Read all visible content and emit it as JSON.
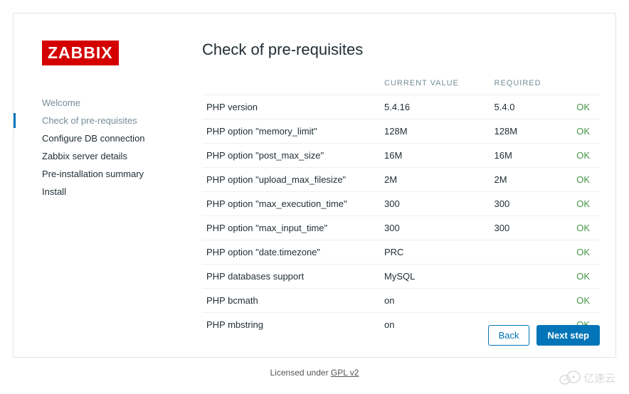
{
  "logo": "ZABBIX",
  "sidebar": {
    "items": [
      {
        "label": "Welcome",
        "state": "done"
      },
      {
        "label": "Check of pre-requisites",
        "state": "active"
      },
      {
        "label": "Configure DB connection",
        "state": "future"
      },
      {
        "label": "Zabbix server details",
        "state": "future"
      },
      {
        "label": "Pre-installation summary",
        "state": "future"
      },
      {
        "label": "Install",
        "state": "future"
      }
    ]
  },
  "main": {
    "title": "Check of pre-requisites",
    "columns": {
      "empty": "",
      "current": "Current value",
      "required": "Required",
      "status": ""
    },
    "rows": [
      {
        "name": "PHP version",
        "current": "5.4.16",
        "required": "5.4.0",
        "status": "OK"
      },
      {
        "name": "PHP option \"memory_limit\"",
        "current": "128M",
        "required": "128M",
        "status": "OK"
      },
      {
        "name": "PHP option \"post_max_size\"",
        "current": "16M",
        "required": "16M",
        "status": "OK"
      },
      {
        "name": "PHP option \"upload_max_filesize\"",
        "current": "2M",
        "required": "2M",
        "status": "OK"
      },
      {
        "name": "PHP option \"max_execution_time\"",
        "current": "300",
        "required": "300",
        "status": "OK"
      },
      {
        "name": "PHP option \"max_input_time\"",
        "current": "300",
        "required": "300",
        "status": "OK"
      },
      {
        "name": "PHP option \"date.timezone\"",
        "current": "PRC",
        "required": "",
        "status": "OK"
      },
      {
        "name": "PHP databases support",
        "current": "MySQL",
        "required": "",
        "status": "OK"
      },
      {
        "name": "PHP bcmath",
        "current": "on",
        "required": "",
        "status": "OK"
      },
      {
        "name": "PHP mbstring",
        "current": "on",
        "required": "",
        "status": "OK"
      }
    ]
  },
  "buttons": {
    "back": "Back",
    "next": "Next step"
  },
  "license": {
    "prefix": "Licensed under ",
    "link": "GPL v2"
  },
  "watermark": "亿速云"
}
